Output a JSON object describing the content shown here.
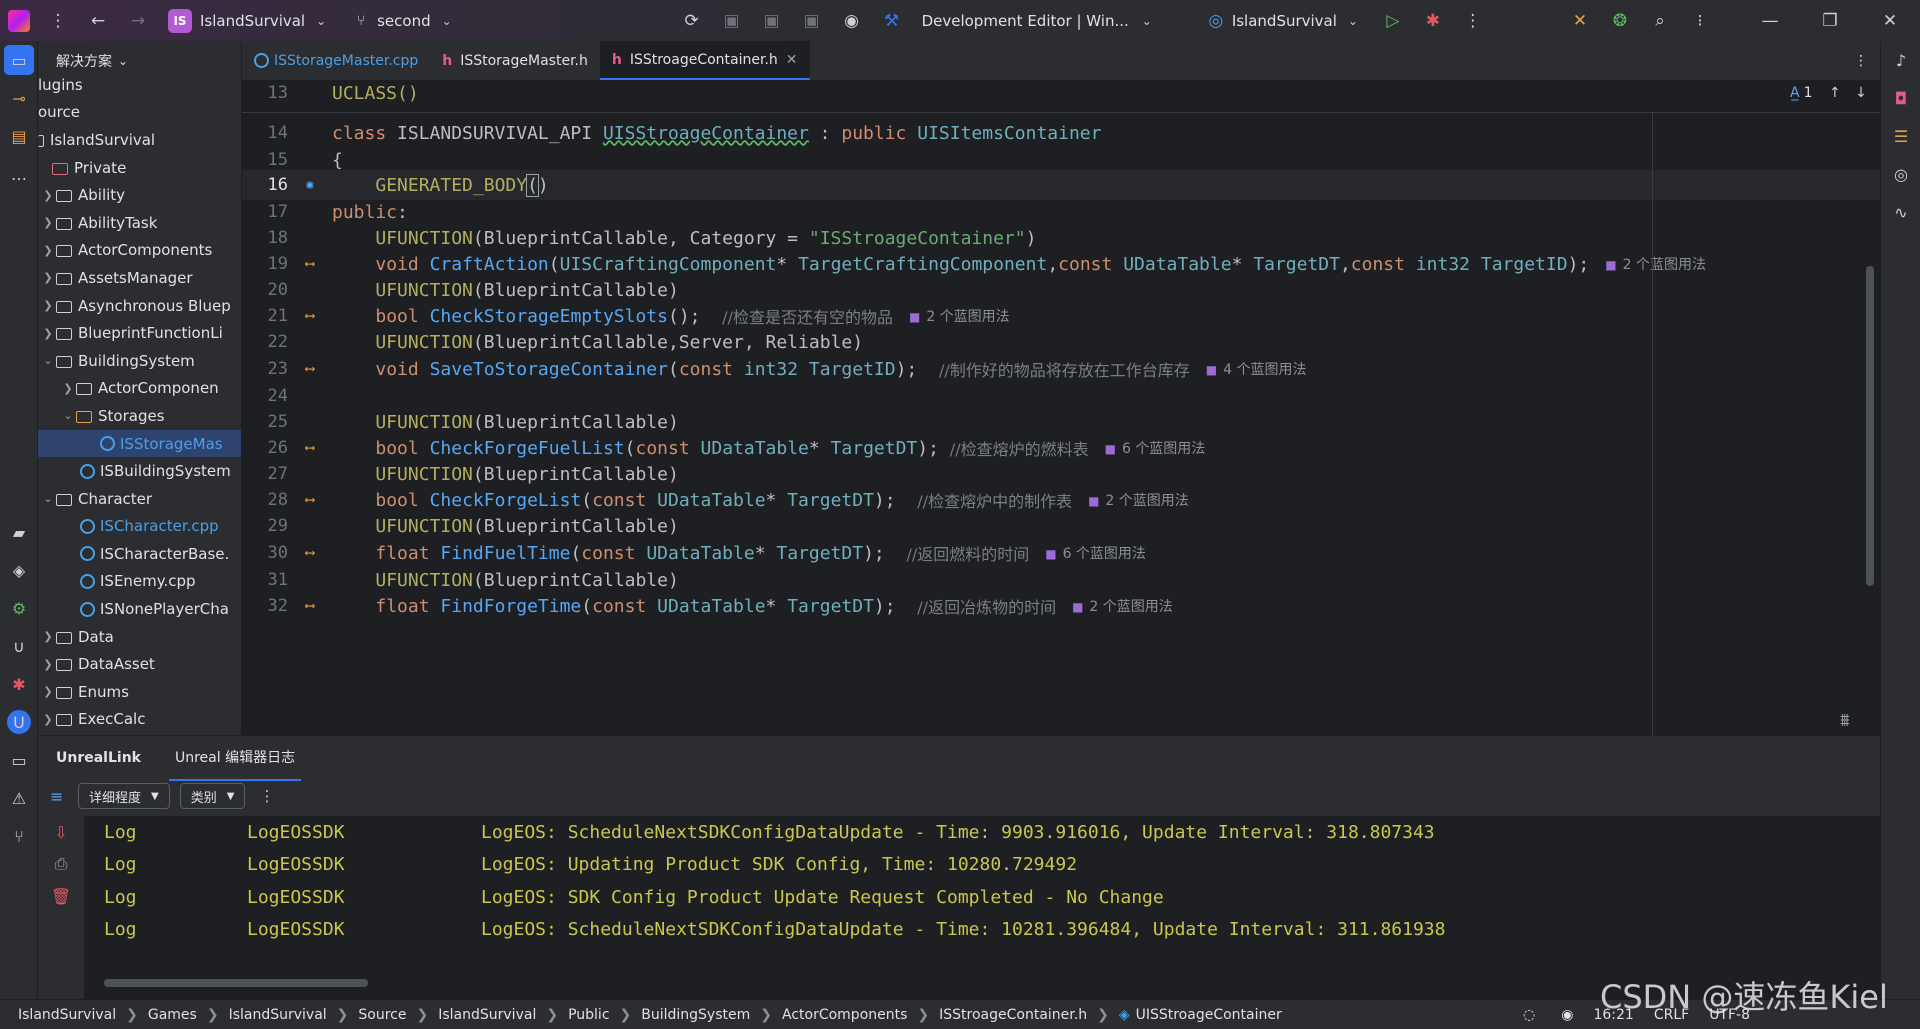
{
  "titlebar": {
    "project_badge": "IS",
    "project_name": "IslandSurvival",
    "branch": "second",
    "run_config": "Development Editor | Win...",
    "target_project": "IslandSurvival"
  },
  "project_panel": {
    "header": "解决方案",
    "rows": [
      {
        "label": "lugins"
      },
      {
        "label": "ource"
      },
      {
        "label": "IslandSurvival"
      },
      {
        "label": "Private"
      },
      {
        "label": "Ability"
      },
      {
        "label": "AbilityTask"
      },
      {
        "label": "ActorComponents"
      },
      {
        "label": "AssetsManager"
      },
      {
        "label": "Asynchronous Bluep"
      },
      {
        "label": "BlueprintFunctionLi"
      },
      {
        "label": "BuildingSystem"
      },
      {
        "label": "ActorComponen"
      },
      {
        "label": "Storages"
      },
      {
        "label": "ISStorageMas"
      },
      {
        "label": "ISBuildingSystem"
      },
      {
        "label": "Character"
      },
      {
        "label": "ISCharacter.cpp"
      },
      {
        "label": "ISCharacterBase."
      },
      {
        "label": "ISEnemy.cpp"
      },
      {
        "label": "ISNonePlayerCha"
      },
      {
        "label": "Data"
      },
      {
        "label": "DataAsset"
      },
      {
        "label": "Enums"
      },
      {
        "label": "ExecCalc"
      }
    ]
  },
  "editor_tabs": [
    {
      "label": "ISStorageMaster.cpp"
    },
    {
      "label": "ISStorageMaster.h"
    },
    {
      "label": "ISStroageContainer.h"
    }
  ],
  "editor": {
    "inspection_count": "1",
    "lines": [
      {
        "num": "13"
      },
      {
        "num": "14"
      },
      {
        "num": "15"
      },
      {
        "num": "16"
      },
      {
        "num": "17"
      },
      {
        "num": "18"
      },
      {
        "num": "19",
        "hint": "2 个蓝图用法"
      },
      {
        "num": "20"
      },
      {
        "num": "21",
        "comment": "//检查是否还有空的物品",
        "hint": "2 个蓝图用法"
      },
      {
        "num": "22"
      },
      {
        "num": "23",
        "comment": "//制作好的物品将存放在工作台库存",
        "hint": "4 个蓝图用法"
      },
      {
        "num": "24"
      },
      {
        "num": "25"
      },
      {
        "num": "26",
        "comment": "//检查熔炉的燃料表",
        "hint": "6 个蓝图用法"
      },
      {
        "num": "27"
      },
      {
        "num": "28",
        "comment": "//检查熔炉中的制作表",
        "hint": "2 个蓝图用法"
      },
      {
        "num": "29"
      },
      {
        "num": "30",
        "comment": "//返回燃料的时间",
        "hint": "6 个蓝图用法"
      },
      {
        "num": "31"
      },
      {
        "num": "32",
        "comment": "//返回冶炼物的时间",
        "hint": "2 个蓝图用法"
      }
    ]
  },
  "bottom_panel": {
    "tabs": [
      {
        "label": "UnrealLink"
      },
      {
        "label": "Unreal 编辑器日志"
      }
    ],
    "verbosity_dropdown": "详细程度",
    "category_dropdown": "类别",
    "log": [
      {
        "level": "Log",
        "category": "LogEOSSDK",
        "message": "LogEOS: ScheduleNextSDKConfigDataUpdate - Time: 9903.916016, Update Interval: 318.807343"
      },
      {
        "level": "Log",
        "category": "LogEOSSDK",
        "message": "LogEOS: Updating Product SDK Config, Time: 10280.729492"
      },
      {
        "level": "Log",
        "category": "LogEOSSDK",
        "message": "LogEOS: SDK Config Product Update Request Completed - No Change"
      },
      {
        "level": "Log",
        "category": "LogEOSSDK",
        "message": "LogEOS: ScheduleNextSDKConfigDataUpdate - Time: 10281.396484, Update Interval: 311.861938"
      }
    ]
  },
  "statusbar": {
    "breadcrumbs": [
      "IslandSurvival",
      "Games",
      "IslandSurvival",
      "Source",
      "IslandSurvival",
      "Public",
      "BuildingSystem",
      "ActorComponents",
      "ISStroageContainer.h",
      "UISStroageContainer"
    ],
    "position": "16:21",
    "line_ending": "CRLF",
    "encoding": "UTF-8"
  },
  "watermark": "CSDN @速冻鱼Kiel",
  "colors": {
    "accent": "#3574f0",
    "log_text": "#c9c74d",
    "keyword": "#cf8e6d",
    "type": "#6fafbd",
    "function": "#56a8f5"
  }
}
